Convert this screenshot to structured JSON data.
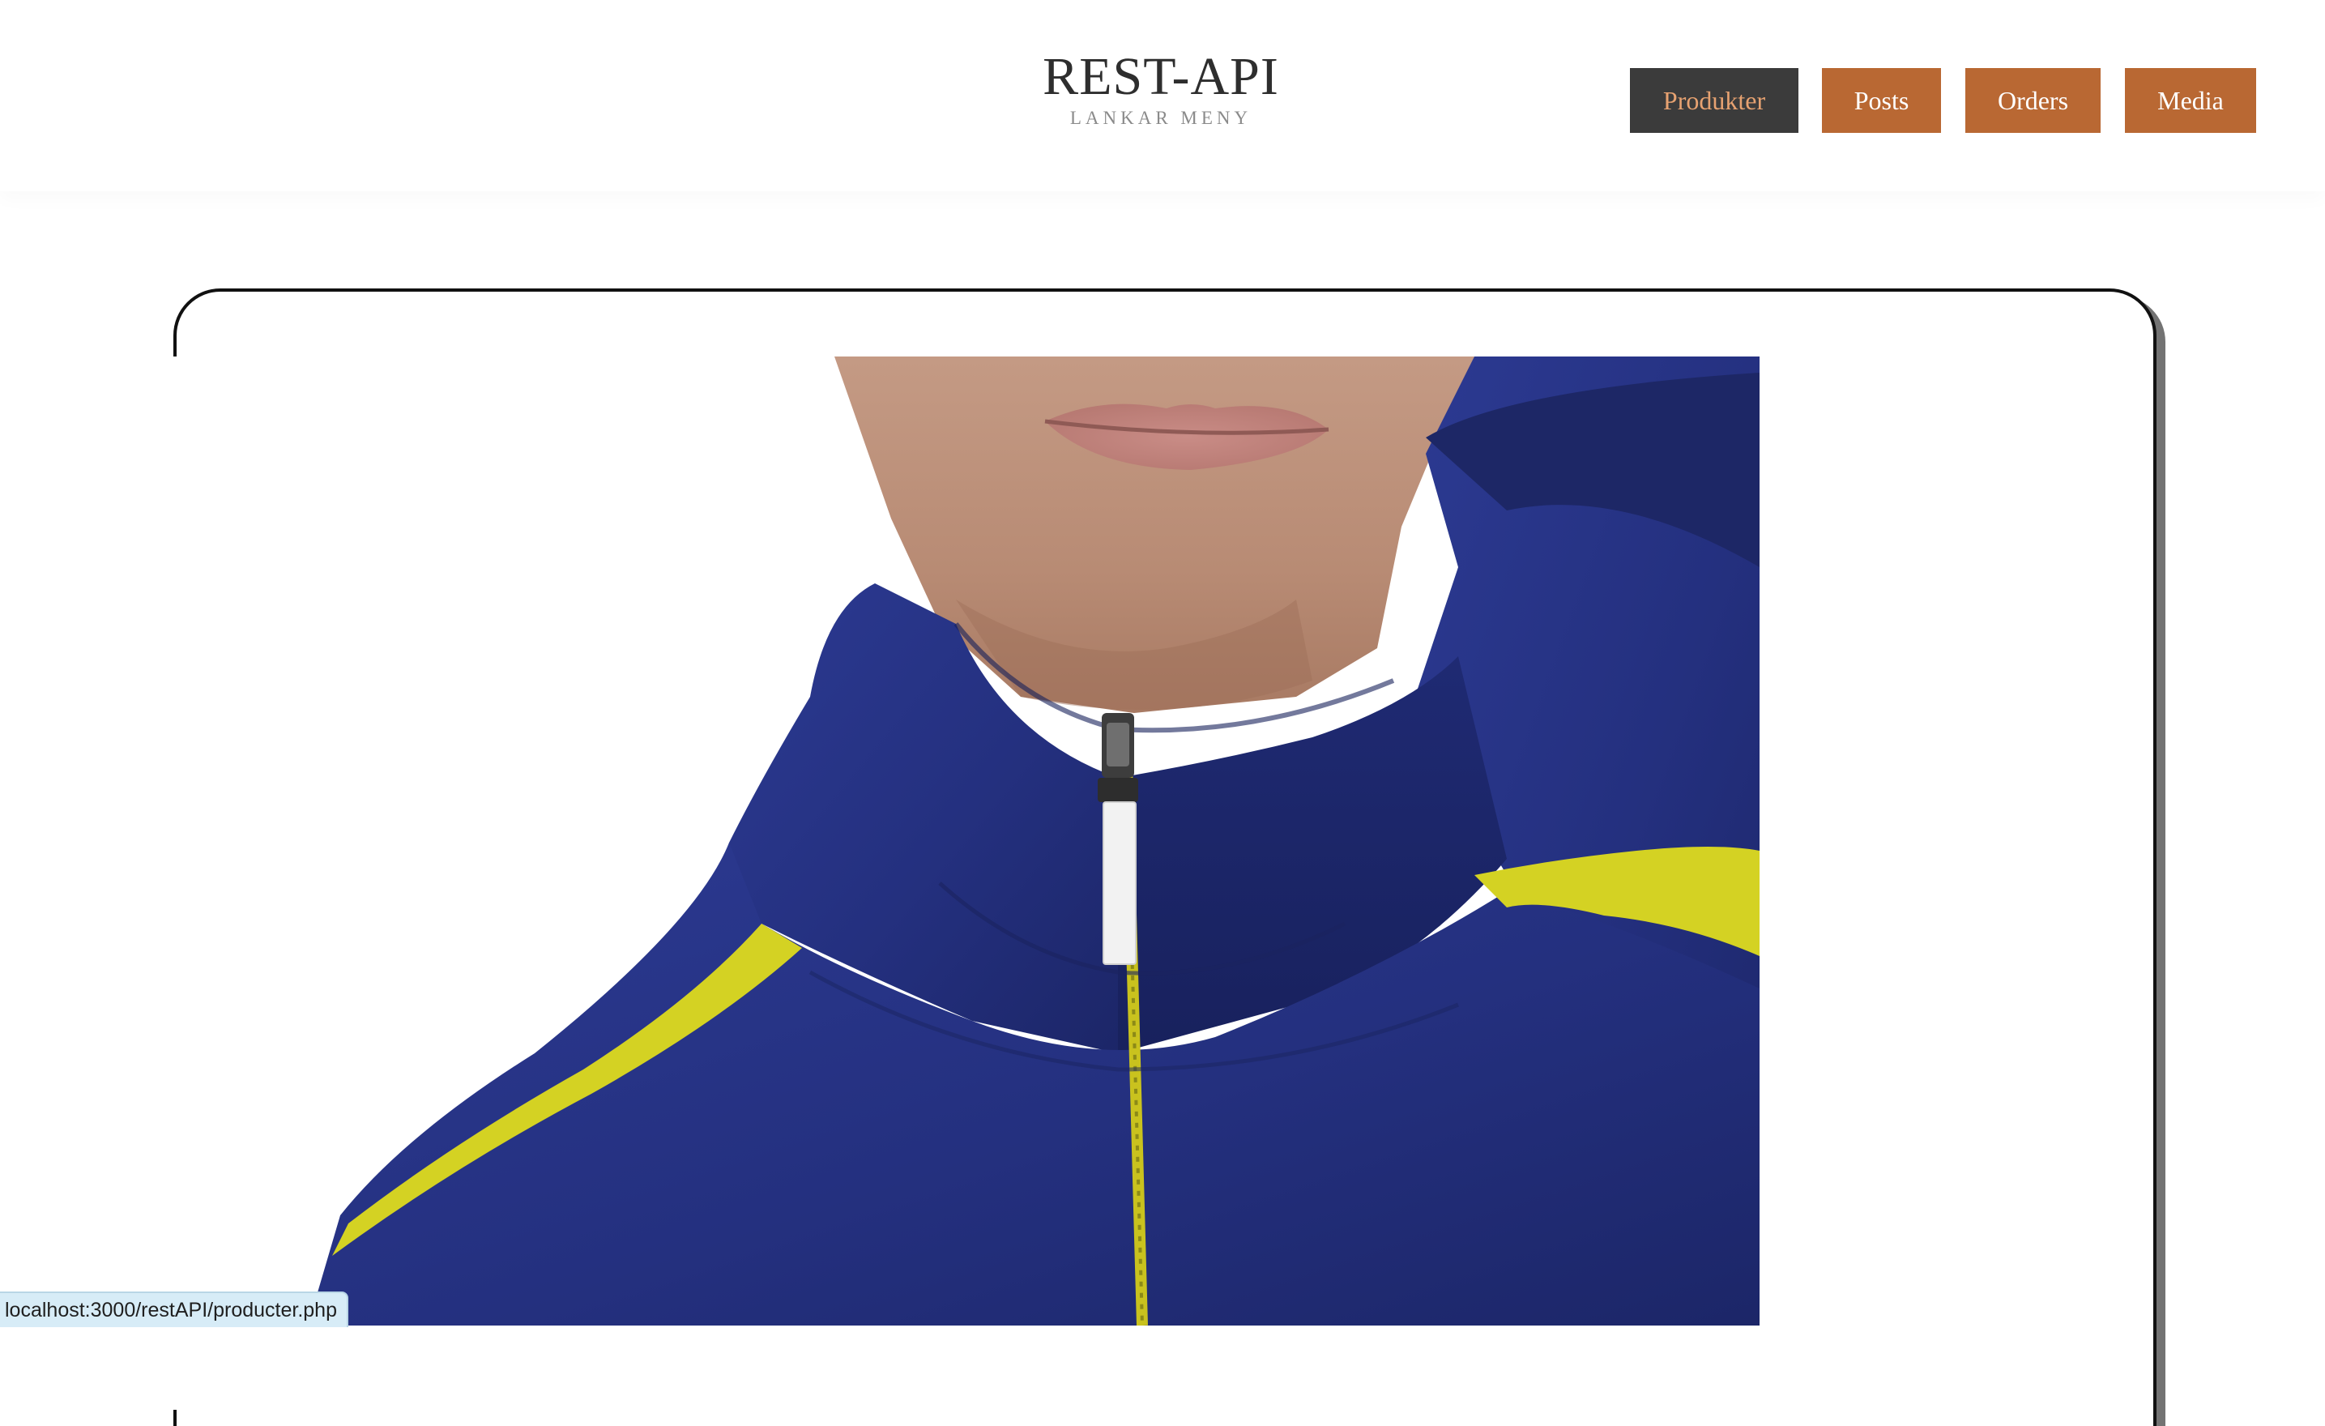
{
  "brand": {
    "title": "REST-API",
    "subtitle": "LANKAR MENY"
  },
  "nav": {
    "items": [
      {
        "label": "Produkter",
        "active": true
      },
      {
        "label": "Posts",
        "active": false
      },
      {
        "label": "Orders",
        "active": false
      },
      {
        "label": "Media",
        "active": false
      }
    ]
  },
  "product": {
    "image_subject": "blue zip hoodie with yellow shoulder stripes"
  },
  "status_bar": {
    "url": "localhost:3000/restAPI/producter.php"
  },
  "colors": {
    "nav_button": "#b96833",
    "nav_active_bg": "#3b3b3b",
    "nav_active_text": "#e7a271",
    "hoodie_blue": "#24307f",
    "stripe_yellow": "#d4d223",
    "card_border": "#111111"
  }
}
